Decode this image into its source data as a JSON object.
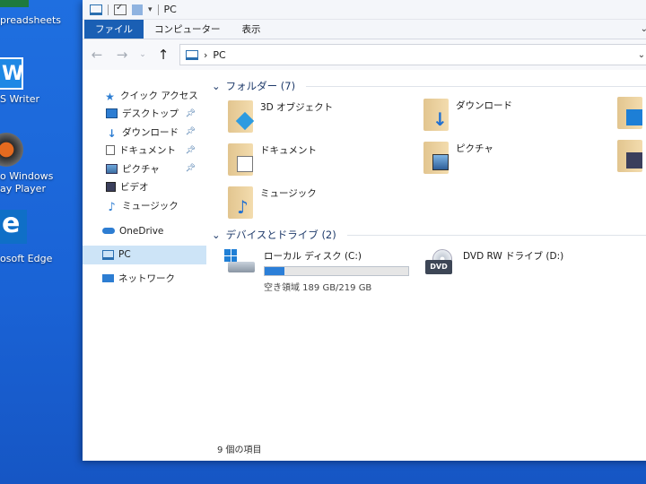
{
  "desktop": {
    "icons": [
      {
        "label": "preadsheets"
      },
      {
        "label": "S Writer"
      },
      {
        "label_lines": [
          "o Windows",
          "ay Player"
        ]
      },
      {
        "label": "osoft Edge"
      }
    ]
  },
  "window": {
    "title": "PC",
    "ribbon": {
      "tabs": [
        "ファイル",
        "コンピューター",
        "表示"
      ]
    },
    "address": {
      "path": "PC"
    },
    "sidebar": {
      "quick_access": "クイック アクセス",
      "items": [
        {
          "label": "デスクトップ",
          "icon": "desktop-icon",
          "pinned": true
        },
        {
          "label": "ダウンロード",
          "icon": "download-icon",
          "pinned": true
        },
        {
          "label": "ドキュメント",
          "icon": "document-icon",
          "pinned": true
        },
        {
          "label": "ピクチャ",
          "icon": "picture-icon",
          "pinned": true
        },
        {
          "label": "ビデオ",
          "icon": "video-icon",
          "pinned": false
        },
        {
          "label": "ミュージック",
          "icon": "music-icon",
          "pinned": false
        }
      ],
      "onedrive": "OneDrive",
      "pc": "PC",
      "network": "ネットワーク"
    },
    "folders_header": "フォルダー (7)",
    "folders": [
      {
        "label": "3D オブジェクト",
        "icon": "3d-objects-folder-icon"
      },
      {
        "label": "ダウンロード",
        "icon": "downloads-folder-icon"
      },
      {
        "label": "ドキュメント",
        "icon": "documents-folder-icon"
      },
      {
        "label": "ピクチャ",
        "icon": "pictures-folder-icon"
      },
      {
        "label": "ミュージック",
        "icon": "music-folder-icon"
      }
    ],
    "drives_header": "デバイスとドライブ (2)",
    "drives": [
      {
        "label": "ローカル ディスク (C:)",
        "free_text": "空き領域 189 GB/219 GB",
        "used_fraction": 0.137
      },
      {
        "label": "DVD RW ドライブ (D:)",
        "badge": "DVD"
      }
    ],
    "status": "9 個の項目"
  },
  "colors": {
    "accent": "#1a5fb4",
    "selection": "#cde4f7",
    "drive_bar": "#2b7fd8"
  }
}
